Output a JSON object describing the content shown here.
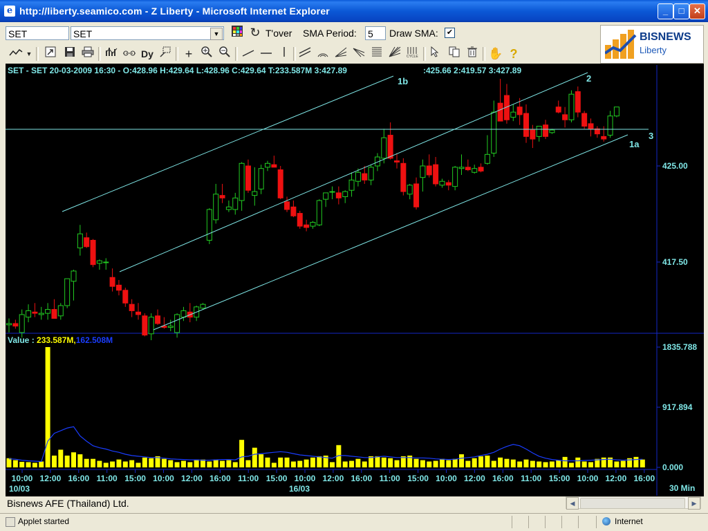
{
  "window": {
    "title": "http://liberty.seamico.com - Z Liberty - Microsoft Internet Explorer",
    "min": "_",
    "max": "□",
    "close": "✕"
  },
  "toolbar1": {
    "symbol_value": "SET",
    "symbol_select": "SET",
    "tover_label": "T'over",
    "sma_period_label": "SMA Period:",
    "sma_period_value": "5",
    "draw_sma_label": "Draw SMA:",
    "draw_sma_checked": "✔"
  },
  "toolbar2": {
    "icons": [
      "line-chart-icon",
      "dropdown-arrow-icon",
      "zoom-window-icon",
      "save-icon",
      "print-icon",
      "indicator-icon",
      "compare-icon",
      "dy-icon",
      "snap-icon",
      "crosshair-icon",
      "zoom-in-icon",
      "zoom-out-icon",
      "trendline-icon",
      "horizontal-line-icon",
      "vertical-line-icon",
      "channel-icon",
      "arc-icon",
      "fan-icon",
      "speed-line-icon",
      "fibonacci-icon",
      "gann-fan-icon",
      "cycle-icon",
      "select-icon",
      "copy-icon",
      "delete-icon",
      "hand-icon",
      "help-icon"
    ],
    "dy_label": "Dy"
  },
  "logo": {
    "brand": "BISNEWS",
    "sub": "Liberty"
  },
  "chart": {
    "info_line": "SET - SET 20-03-2009 16:30 - O:428.96  H:429.64  L:428.96  C:429.64  T:233.587M  3:427.89",
    "info_extra": ":425.66  2:419.57  3:427.89",
    "price_labels": [
      "425.00",
      "417.50"
    ],
    "annotations": {
      "a1b": "1b",
      "a2": "2",
      "a3": "3",
      "a1a": "1a"
    },
    "volume_label_prefix": "Value : ",
    "volume_value": "233.587M,",
    "volume_sma": "162.508M",
    "volume_axis_labels": [
      "1835.788",
      "917.894",
      "0.000"
    ],
    "x_labels": [
      "10:00",
      "12:00",
      "16:00",
      "11:00",
      "15:00",
      "10:00",
      "12:00",
      "16:00",
      "11:00",
      "15:00",
      "10:00",
      "12:00",
      "16:00",
      "11:00",
      "15:00",
      "10:00",
      "12:00",
      "16:00",
      "11:00",
      "15:00",
      "10:00",
      "12:00",
      "16:00"
    ],
    "date_labels": [
      "10/03",
      "16/03"
    ],
    "timeframe": "30 Min",
    "colors": {
      "up": "#22cc22",
      "down": "#ee1111",
      "lines": "#7fe6e6",
      "volume": "#ffff00",
      "sma": "#1a3dff",
      "text": "#7fe6e6"
    }
  },
  "chart_data": {
    "type": "candlestick",
    "title": "SET - SET 20-03-2009 16:30",
    "ohlc_latest": {
      "open": 428.96,
      "high": 429.64,
      "low": 428.96,
      "close": 429.64
    },
    "ylabels": [
      425.0,
      417.5
    ],
    "candles": [
      [
        412.6,
        413.1,
        412.0,
        412.7
      ],
      [
        412.7,
        413.0,
        412.3,
        412.5
      ],
      [
        412.0,
        413.8,
        411.6,
        413.4
      ],
      [
        413.2,
        414.2,
        412.8,
        413.7
      ],
      [
        413.6,
        414.3,
        413.2,
        413.5
      ],
      [
        413.4,
        414.0,
        413.0,
        413.5
      ],
      [
        413.5,
        414.3,
        413.0,
        413.8
      ],
      [
        413.8,
        414.6,
        413.2,
        413.1
      ],
      [
        413.3,
        414.3,
        413.0,
        414.1
      ],
      [
        414.1,
        416.2,
        413.9,
        416.2
      ],
      [
        416.0,
        416.9,
        414.5,
        416.8
      ],
      [
        418.6,
        420.4,
        418.0,
        419.7
      ],
      [
        419.4,
        419.8,
        418.6,
        418.7
      ],
      [
        419.2,
        419.3,
        417.1,
        417.3
      ],
      [
        417.4,
        417.7,
        416.9,
        417.6
      ],
      [
        417.5,
        417.8,
        416.9,
        417.5
      ],
      [
        416.3,
        417.0,
        415.2,
        415.6
      ],
      [
        415.7,
        416.1,
        414.9,
        415.3
      ],
      [
        415.3,
        415.5,
        414.0,
        414.3
      ],
      [
        414.2,
        414.6,
        413.2,
        413.7
      ],
      [
        413.6,
        414.3,
        413.0,
        413.4
      ],
      [
        413.3,
        413.5,
        411.7,
        411.8
      ],
      [
        411.9,
        413.5,
        411.4,
        413.2
      ],
      [
        413.3,
        413.8,
        412.6,
        412.7
      ],
      [
        412.5,
        413.2,
        412.3,
        412.4
      ],
      [
        412.4,
        413.0,
        412.1,
        412.5
      ],
      [
        412.0,
        413.5,
        411.6,
        413.4
      ],
      [
        413.2,
        414.0,
        412.9,
        413.7
      ],
      [
        413.6,
        414.3,
        412.8,
        413.2
      ],
      [
        413.2,
        414.1,
        412.9,
        414.0
      ],
      [
        413.9,
        414.3,
        413.8,
        414.2
      ],
      [
        419.2,
        421.7,
        418.9,
        421.6
      ],
      [
        420.8,
        423.6,
        420.5,
        422.8
      ],
      [
        422.7,
        423.6,
        422.1,
        422.5
      ],
      [
        421.6,
        422.3,
        421.4,
        421.8
      ],
      [
        421.6,
        422.9,
        421.2,
        422.5
      ],
      [
        422.3,
        425.3,
        421.5,
        425.2
      ],
      [
        425.0,
        425.5,
        422.9,
        423.1
      ],
      [
        422.7,
        424.9,
        421.9,
        423.0
      ],
      [
        423.2,
        425.1,
        422.8,
        424.8
      ],
      [
        424.9,
        425.4,
        424.6,
        425.2
      ],
      [
        425.1,
        425.8,
        424.9,
        424.9
      ],
      [
        424.7,
        425.0,
        422.4,
        422.5
      ],
      [
        422.2,
        422.6,
        421.4,
        421.6
      ],
      [
        421.8,
        422.3,
        421.0,
        421.1
      ],
      [
        421.3,
        421.5,
        420.1,
        420.3
      ],
      [
        420.4,
        420.8,
        419.9,
        420.2
      ],
      [
        420.3,
        420.7,
        420.1,
        420.6
      ],
      [
        420.4,
        422.4,
        420.3,
        422.3
      ],
      [
        422.4,
        422.7,
        421.8,
        422.9
      ],
      [
        423.0,
        423.4,
        422.4,
        423.0
      ],
      [
        422.9,
        423.4,
        422.0,
        422.5
      ],
      [
        422.6,
        423.1,
        422.1,
        423.0
      ],
      [
        423.1,
        424.5,
        422.6,
        423.9
      ],
      [
        423.8,
        424.8,
        423.4,
        424.5
      ],
      [
        424.4,
        425.0,
        423.6,
        423.9
      ],
      [
        423.9,
        425.1,
        423.5,
        424.9
      ],
      [
        425.0,
        426.0,
        424.6,
        425.7
      ],
      [
        425.6,
        427.9,
        425.2,
        427.2
      ],
      [
        427.4,
        428.4,
        425.5,
        425.6
      ],
      [
        425.4,
        426.0,
        424.8,
        425.3
      ],
      [
        425.2,
        425.6,
        422.7,
        423.0
      ],
      [
        422.8,
        423.6,
        422.4,
        423.5
      ],
      [
        423.6,
        424.1,
        421.6,
        421.8
      ],
      [
        424.1,
        425.5,
        423.0,
        425.0
      ],
      [
        425.0,
        425.9,
        424.1,
        424.3
      ],
      [
        425.1,
        425.7,
        423.4,
        423.6
      ],
      [
        423.5,
        424.0,
        423.3,
        423.8
      ],
      [
        423.7,
        423.9,
        423.1,
        423.5
      ],
      [
        423.4,
        425.0,
        423.1,
        424.9
      ],
      [
        424.8,
        425.9,
        424.3,
        424.9
      ],
      [
        424.9,
        425.5,
        424.6,
        424.7
      ],
      [
        424.5,
        425.1,
        424.4,
        424.8
      ],
      [
        424.9,
        425.2,
        424.5,
        424.6
      ],
      [
        425.2,
        427.4,
        425.1,
        425.9
      ],
      [
        426.0,
        430.1,
        425.7,
        429.2
      ],
      [
        429.9,
        431.8,
        428.7,
        428.5
      ],
      [
        430.5,
        431.4,
        428.3,
        428.6
      ],
      [
        428.8,
        429.8,
        428.5,
        429.2
      ],
      [
        429.6,
        430.3,
        428.2,
        429.0
      ],
      [
        429.1,
        429.8,
        426.8,
        427.3
      ],
      [
        427.8,
        428.2,
        426.4,
        427.1
      ],
      [
        427.3,
        428.1,
        426.9,
        428.1
      ],
      [
        428.2,
        428.6,
        427.1,
        427.3
      ],
      [
        427.6,
        427.9,
        427.5,
        427.8
      ],
      [
        429.6,
        430.1,
        429.1,
        429.2
      ],
      [
        429.0,
        429.6,
        428.0,
        428.6
      ],
      [
        428.6,
        430.9,
        428.4,
        430.6
      ],
      [
        430.8,
        431.2,
        428.8,
        429.2
      ],
      [
        429.1,
        429.3,
        427.9,
        428.1
      ],
      [
        428.3,
        428.7,
        427.3,
        427.9
      ],
      [
        427.9,
        428.1,
        427.2,
        427.5
      ],
      [
        427.3,
        428.1,
        426.9,
        427.1
      ],
      [
        427.4,
        429.3,
        427.2,
        428.9
      ],
      [
        428.9,
        429.6,
        428.8,
        429.6
      ]
    ],
    "volume_axis": [
      0.0,
      917.894,
      1835.788
    ],
    "volume_values": [
      140,
      110,
      85,
      80,
      70,
      90,
      1835.788,
      180,
      270,
      180,
      230,
      200,
      130,
      130,
      100,
      70,
      90,
      120,
      90,
      110,
      70,
      150,
      140,
      170,
      130,
      110,
      80,
      100,
      80,
      120,
      120,
      90,
      120,
      100,
      110,
      80,
      420,
      110,
      300,
      200,
      150,
      70,
      150,
      150,
      90,
      100,
      120,
      150,
      170,
      180,
      80,
      340,
      90,
      100,
      130,
      90,
      170,
      170,
      150,
      140,
      110,
      170,
      180,
      130,
      110,
      90,
      100,
      130,
      110,
      130,
      200,
      100,
      140,
      170,
      180,
      100,
      150,
      130,
      120,
      90,
      120,
      100,
      90,
      80,
      90,
      110,
      160,
      70,
      150,
      90,
      80,
      130,
      150,
      150,
      90,
      100,
      140,
      160,
      120
    ],
    "volume_sma": [
      130,
      125,
      110,
      100,
      95,
      90,
      400,
      520,
      560,
      600,
      620,
      480,
      400,
      330,
      300,
      280,
      250,
      230,
      200,
      180,
      170,
      160,
      150,
      150,
      140,
      130,
      125,
      120,
      115,
      115,
      110,
      110,
      115,
      120,
      120,
      115,
      160,
      170,
      200,
      210,
      220,
      230,
      240,
      230,
      210,
      190,
      180,
      170,
      160,
      150,
      140,
      180,
      180,
      170,
      160,
      150,
      150,
      160,
      170,
      160,
      150,
      150,
      150,
      145,
      145,
      140,
      130,
      125,
      120,
      125,
      140,
      150,
      160,
      180,
      200,
      230,
      280,
      320,
      350,
      330,
      280,
      220,
      170,
      140,
      120,
      110,
      100,
      100,
      100,
      105,
      110,
      115,
      120,
      125,
      115,
      110,
      115,
      120,
      125
    ],
    "x_tick_labels": [
      "10:00",
      "12:00",
      "16:00",
      "11:00",
      "15:00",
      "10:00",
      "12:00",
      "16:00",
      "11:00",
      "15:00",
      "10:00",
      "12:00",
      "16:00",
      "11:00",
      "15:00",
      "10:00",
      "12:00",
      "16:00",
      "11:00",
      "15:00",
      "10:00",
      "12:00",
      "16:00"
    ],
    "date_ticks": [
      "10/03",
      "16/03"
    ]
  },
  "status": {
    "company": "Bisnews AFE (Thailand) Ltd.",
    "applet": "Applet started",
    "zone": "Internet"
  }
}
